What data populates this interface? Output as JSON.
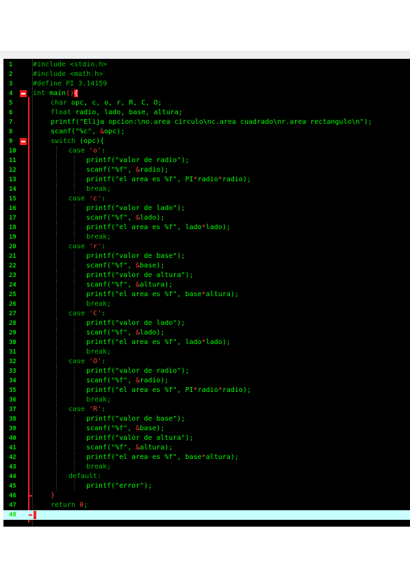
{
  "colors": {
    "background": "#000000",
    "preprocessor": "#00c000",
    "keyword": "#00c000",
    "text": "#00ff00",
    "string": "#00ff00",
    "operator": "#ff4040",
    "line_number": "#00e000",
    "fold_marker": "#ff2020",
    "current_line": "#c8ffff"
  },
  "lines": [
    {
      "n": "1",
      "indent": 0,
      "tokens": [
        {
          "t": "#include <stdio.h>",
          "c": "#00c000"
        }
      ]
    },
    {
      "n": "2",
      "indent": 0,
      "tokens": [
        {
          "t": "#include <math.h>",
          "c": "#00c000"
        }
      ]
    },
    {
      "n": "3",
      "indent": 0,
      "tokens": [
        {
          "t": "#define PI 3.14159",
          "c": "#00c000"
        }
      ]
    },
    {
      "n": "4",
      "indent": 0,
      "fold": "open",
      "tokens": [
        {
          "t": "int ",
          "c": "#00c000"
        },
        {
          "t": "main",
          "c": "#00ff00"
        },
        {
          "t": "()",
          "c": "#ff4040"
        },
        {
          "t": "{",
          "c": "#ffffff",
          "hl": true
        }
      ]
    },
    {
      "n": "5",
      "indent": 1,
      "tokens": [
        {
          "t": "char ",
          "c": "#00c000"
        },
        {
          "t": "opc, c, o, r, R, C, O;",
          "c": "#00ff00"
        }
      ]
    },
    {
      "n": "6",
      "indent": 1,
      "tokens": [
        {
          "t": "float ",
          "c": "#00c000"
        },
        {
          "t": "radio, lado, base, altura;",
          "c": "#00ff00"
        }
      ]
    },
    {
      "n": "7",
      "indent": 1,
      "tokens": [
        {
          "t": "printf(\"Elija opcion:\\no.area circulo\\nc.area cuadrado\\nr.area rectangulo\\n\");",
          "c": "#00ff00"
        }
      ]
    },
    {
      "n": "8",
      "indent": 1,
      "tokens": [
        {
          "t": "scanf(\"%c\", ",
          "c": "#00ff00"
        },
        {
          "t": "&",
          "c": "#ff4040"
        },
        {
          "t": "opc);",
          "c": "#00ff00"
        }
      ]
    },
    {
      "n": "9",
      "indent": 1,
      "fold": "open",
      "tokens": [
        {
          "t": "switch ",
          "c": "#00c000"
        },
        {
          "t": "(opc){",
          "c": "#00ff00"
        }
      ]
    },
    {
      "n": "10",
      "indent": 2,
      "tokens": [
        {
          "t": "case ",
          "c": "#00c000"
        },
        {
          "t": "'o'",
          "c": "#ff4040"
        },
        {
          "t": ":",
          "c": "#00ff00"
        }
      ]
    },
    {
      "n": "11",
      "indent": 3,
      "tokens": [
        {
          "t": "printf(\"valor de radio\");",
          "c": "#00ff00"
        }
      ]
    },
    {
      "n": "12",
      "indent": 3,
      "tokens": [
        {
          "t": "scanf(\"%f\", ",
          "c": "#00ff00"
        },
        {
          "t": "&",
          "c": "#ff4040"
        },
        {
          "t": "radio);",
          "c": "#00ff00"
        }
      ]
    },
    {
      "n": "13",
      "indent": 3,
      "tokens": [
        {
          "t": "printf(\"el area es %f\", PI",
          "c": "#00ff00"
        },
        {
          "t": "*",
          "c": "#ff4040"
        },
        {
          "t": "radio",
          "c": "#00ff00"
        },
        {
          "t": "*",
          "c": "#ff4040"
        },
        {
          "t": "radio);",
          "c": "#00ff00"
        }
      ]
    },
    {
      "n": "14",
      "indent": 3,
      "tokens": [
        {
          "t": "break;",
          "c": "#00c000"
        }
      ]
    },
    {
      "n": "15",
      "indent": 2,
      "tokens": [
        {
          "t": "case ",
          "c": "#00c000"
        },
        {
          "t": "'c'",
          "c": "#ff4040"
        },
        {
          "t": ":",
          "c": "#00ff00"
        }
      ]
    },
    {
      "n": "16",
      "indent": 3,
      "tokens": [
        {
          "t": "printf(\"valor de lado\");",
          "c": "#00ff00"
        }
      ]
    },
    {
      "n": "17",
      "indent": 3,
      "tokens": [
        {
          "t": "scanf(\"%f\", ",
          "c": "#00ff00"
        },
        {
          "t": "&",
          "c": "#ff4040"
        },
        {
          "t": "lado);",
          "c": "#00ff00"
        }
      ]
    },
    {
      "n": "18",
      "indent": 3,
      "tokens": [
        {
          "t": "printf(\"el area es %f\", lado",
          "c": "#00ff00"
        },
        {
          "t": "*",
          "c": "#ff4040"
        },
        {
          "t": "lado);",
          "c": "#00ff00"
        }
      ]
    },
    {
      "n": "19",
      "indent": 3,
      "tokens": [
        {
          "t": "break;",
          "c": "#00c000"
        }
      ]
    },
    {
      "n": "20",
      "indent": 2,
      "tokens": [
        {
          "t": "case ",
          "c": "#00c000"
        },
        {
          "t": "'r'",
          "c": "#ff4040"
        },
        {
          "t": ":",
          "c": "#00ff00"
        }
      ]
    },
    {
      "n": "21",
      "indent": 3,
      "tokens": [
        {
          "t": "printf(\"valor de base\");",
          "c": "#00ff00"
        }
      ]
    },
    {
      "n": "22",
      "indent": 3,
      "tokens": [
        {
          "t": "scanf(\"%f\", ",
          "c": "#00ff00"
        },
        {
          "t": "&",
          "c": "#ff4040"
        },
        {
          "t": "base);",
          "c": "#00ff00"
        }
      ]
    },
    {
      "n": "23",
      "indent": 3,
      "tokens": [
        {
          "t": "printf(\"valor de altura\");",
          "c": "#00ff00"
        }
      ]
    },
    {
      "n": "24",
      "indent": 3,
      "tokens": [
        {
          "t": "scanf(\"%f\", ",
          "c": "#00ff00"
        },
        {
          "t": "&",
          "c": "#ff4040"
        },
        {
          "t": "altura);",
          "c": "#00ff00"
        }
      ]
    },
    {
      "n": "25",
      "indent": 3,
      "tokens": [
        {
          "t": "printf(\"el area es %f\", base",
          "c": "#00ff00"
        },
        {
          "t": "*",
          "c": "#ff4040"
        },
        {
          "t": "altura);",
          "c": "#00ff00"
        }
      ]
    },
    {
      "n": "26",
      "indent": 3,
      "tokens": [
        {
          "t": "break;",
          "c": "#00c000"
        }
      ]
    },
    {
      "n": "27",
      "indent": 2,
      "tokens": [
        {
          "t": "case ",
          "c": "#00c000"
        },
        {
          "t": "'C'",
          "c": "#ff4040"
        },
        {
          "t": ":",
          "c": "#00ff00"
        }
      ]
    },
    {
      "n": "28",
      "indent": 3,
      "tokens": [
        {
          "t": "printf(\"valor de lado\");",
          "c": "#00ff00"
        }
      ]
    },
    {
      "n": "29",
      "indent": 3,
      "tokens": [
        {
          "t": "scanf(\"%f\", ",
          "c": "#00ff00"
        },
        {
          "t": "&",
          "c": "#ff4040"
        },
        {
          "t": "lado);",
          "c": "#00ff00"
        }
      ]
    },
    {
      "n": "30",
      "indent": 3,
      "tokens": [
        {
          "t": "printf(\"el area es %f\", lado",
          "c": "#00ff00"
        },
        {
          "t": "*",
          "c": "#ff4040"
        },
        {
          "t": "lado);",
          "c": "#00ff00"
        }
      ]
    },
    {
      "n": "31",
      "indent": 3,
      "tokens": [
        {
          "t": "break;",
          "c": "#00c000"
        }
      ]
    },
    {
      "n": "32",
      "indent": 2,
      "tokens": [
        {
          "t": "case ",
          "c": "#00c000"
        },
        {
          "t": "'O'",
          "c": "#ff4040"
        },
        {
          "t": ":",
          "c": "#00ff00"
        }
      ]
    },
    {
      "n": "33",
      "indent": 3,
      "tokens": [
        {
          "t": "printf(\"valor de radio\");",
          "c": "#00ff00"
        }
      ]
    },
    {
      "n": "34",
      "indent": 3,
      "tokens": [
        {
          "t": "scanf(\"%f\", ",
          "c": "#00ff00"
        },
        {
          "t": "&",
          "c": "#ff4040"
        },
        {
          "t": "radio);",
          "c": "#00ff00"
        }
      ]
    },
    {
      "n": "35",
      "indent": 3,
      "tokens": [
        {
          "t": "printf(\"el area es %f\", PI",
          "c": "#00ff00"
        },
        {
          "t": "*",
          "c": "#ff4040"
        },
        {
          "t": "radio",
          "c": "#00ff00"
        },
        {
          "t": "*",
          "c": "#ff4040"
        },
        {
          "t": "radio);",
          "c": "#00ff00"
        }
      ]
    },
    {
      "n": "36",
      "indent": 3,
      "tokens": [
        {
          "t": "break;",
          "c": "#00c000"
        }
      ]
    },
    {
      "n": "37",
      "indent": 2,
      "tokens": [
        {
          "t": "case ",
          "c": "#00c000"
        },
        {
          "t": "'R'",
          "c": "#ff4040"
        },
        {
          "t": ":",
          "c": "#00ff00"
        }
      ]
    },
    {
      "n": "38",
      "indent": 3,
      "tokens": [
        {
          "t": "printf(\"valor de base\");",
          "c": "#00ff00"
        }
      ]
    },
    {
      "n": "39",
      "indent": 3,
      "tokens": [
        {
          "t": "scanf(\"%f\", ",
          "c": "#00ff00"
        },
        {
          "t": "&",
          "c": "#ff4040"
        },
        {
          "t": "base);",
          "c": "#00ff00"
        }
      ]
    },
    {
      "n": "40",
      "indent": 3,
      "tokens": [
        {
          "t": "printf(\"valor de altura\");",
          "c": "#00ff00"
        }
      ]
    },
    {
      "n": "41",
      "indent": 3,
      "tokens": [
        {
          "t": "scanf(\"%f\", ",
          "c": "#00ff00"
        },
        {
          "t": "&",
          "c": "#ff4040"
        },
        {
          "t": "altura);",
          "c": "#00ff00"
        }
      ]
    },
    {
      "n": "42",
      "indent": 3,
      "tokens": [
        {
          "t": "printf(\"el area es %f\", base",
          "c": "#00ff00"
        },
        {
          "t": "*",
          "c": "#ff4040"
        },
        {
          "t": "altura);",
          "c": "#00ff00"
        }
      ]
    },
    {
      "n": "43",
      "indent": 3,
      "tokens": [
        {
          "t": "break;",
          "c": "#00c000"
        }
      ]
    },
    {
      "n": "44",
      "indent": 2,
      "tokens": [
        {
          "t": "default:",
          "c": "#00c000"
        }
      ]
    },
    {
      "n": "45",
      "indent": 3,
      "tokens": [
        {
          "t": "printf(\"error\");",
          "c": "#00ff00"
        }
      ]
    },
    {
      "n": "46",
      "indent": 1,
      "fold": "end",
      "tokens": [
        {
          "t": "}",
          "c": "#ff4040"
        }
      ]
    },
    {
      "n": "47",
      "indent": 1,
      "tokens": [
        {
          "t": "return ",
          "c": "#00c000"
        },
        {
          "t": "0",
          "c": "#ff4040"
        },
        {
          "t": ";",
          "c": "#00ff00"
        }
      ]
    },
    {
      "n": "48",
      "indent": 0,
      "fold": "end",
      "current": true,
      "tokens": [
        {
          "t": "",
          "c": "#000000"
        }
      ]
    }
  ]
}
